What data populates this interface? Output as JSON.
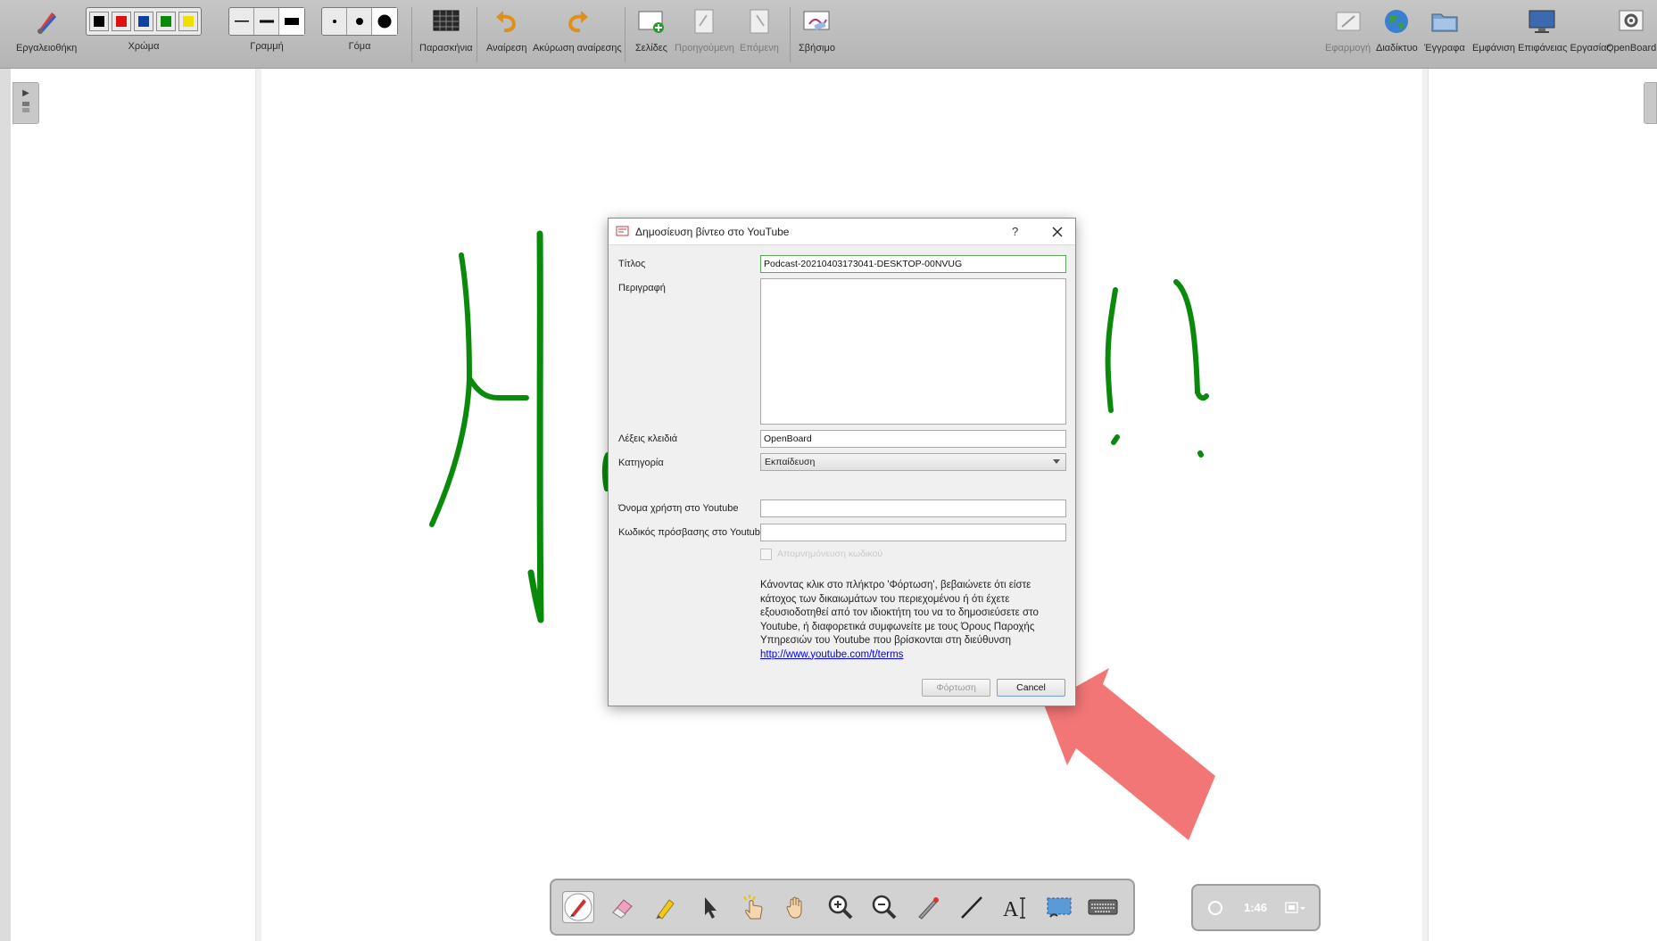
{
  "toolbar": {
    "toolbox_label": "Εργαλειοθήκη",
    "color_label": "Χρώμα",
    "colors": [
      "#000000",
      "#e01010",
      "#1040a0",
      "#0a8a0a",
      "#f0e000"
    ],
    "line_label": "Γραμμή",
    "font_label": "Γόμα",
    "background_label": "Παρασκήνια",
    "undo_label": "Αναίρεση",
    "redo_label": "Ακύρωση αναίρεσης",
    "pages_label": "Σελίδες",
    "previous_label": "Προηγούμενη",
    "next_label": "Επόμενη",
    "erase_label": "Σβήσιμο",
    "app_label": "Εφαρμογή",
    "web_label": "Διαδίκτυο",
    "documents_label": "Έγγραφα",
    "desktop_label": "Εμφάνιση Επιφάνειας Εργασίας",
    "openboard_label": "OpenBoard"
  },
  "dialog": {
    "title": "Δημοσίευση βίντεο στο YouTube",
    "help": "?",
    "title_label": "Τίτλος",
    "title_value": "Podcast-20210403173041-DESKTOP-00NVUG",
    "description_label": "Περιγραφή",
    "description_value": "",
    "keywords_label": "Λέξεις κλειδιά",
    "keywords_value": "OpenBoard",
    "category_label": "Κατηγορία",
    "category_value": "Εκπαίδευση",
    "username_label": "Όνομα χρήστη στο Youtube",
    "username_value": "",
    "password_label": "Κωδικός πρόσβασης στο Youtube",
    "password_value": "",
    "remember_label": "Απομνημόνευση κωδικού",
    "notice_text": "Κάνοντας κλικ στο πλήκτρο 'Φόρτωση', βεβαιώνετε ότι είστε κάτοχος των δικαιωμάτων του περιεχομένου ή ότι έχετε εξουσιοδοτηθεί από τον ιδιοκτήτη του να το δημοσιεύσετε στο Youtube, ή διαφορετικά συμφωνείτε με τους Όρους Παροχής Υπηρεσιών του Youtube που βρίσκονται στη διεύθυνση",
    "notice_link": "http://www.youtube.com/t/terms",
    "upload_button": "Φόρτωση",
    "cancel_button": "Cancel"
  },
  "podcast": {
    "time": "1:46"
  },
  "palette": {
    "tools": [
      "pen-icon",
      "eraser-icon",
      "marker-icon",
      "selector-icon",
      "interact-icon",
      "hand-icon",
      "zoom-in-icon",
      "zoom-out-icon",
      "laser-pointer-icon",
      "line-icon",
      "text-icon",
      "capture-icon",
      "keyboard-icon"
    ]
  },
  "colors": {
    "ink": "#0a8a0a",
    "annotation_arrow": "#f26f6f",
    "toolbar_bg": "#bdbdbd"
  }
}
